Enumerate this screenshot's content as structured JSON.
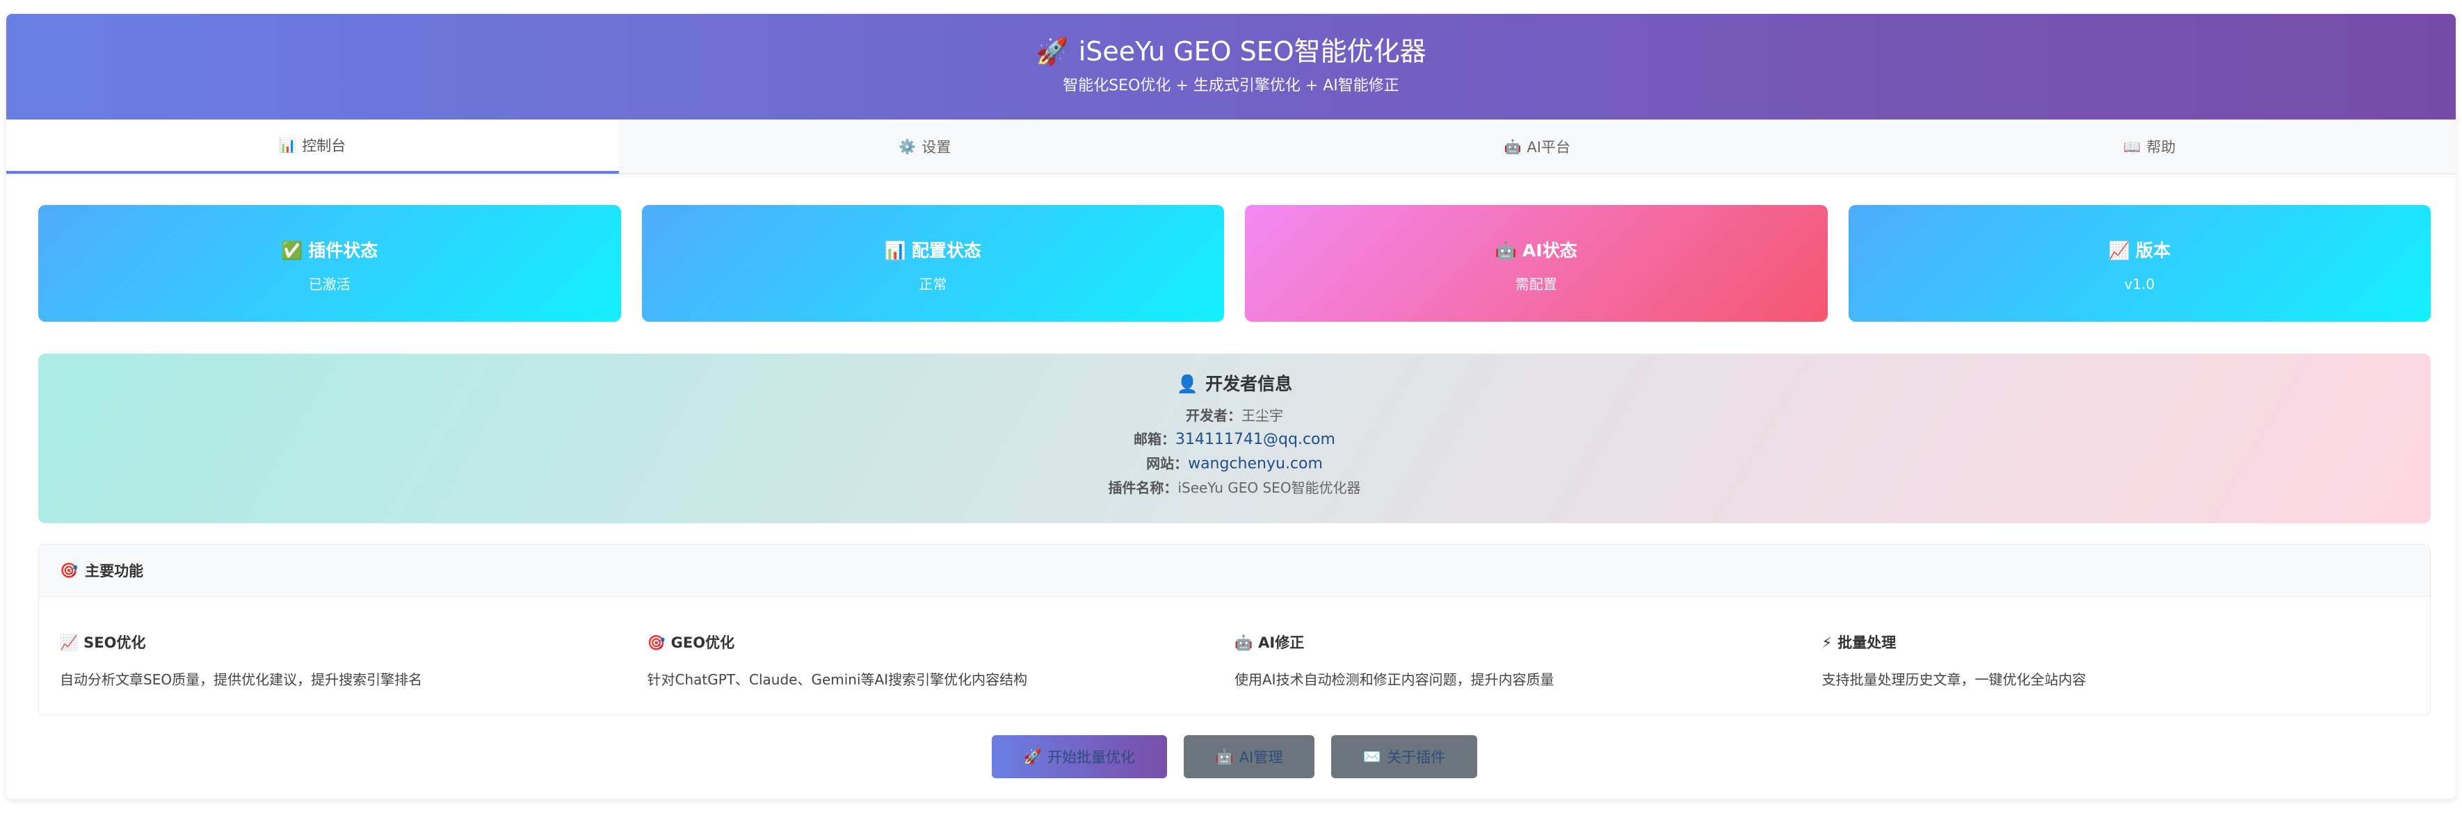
{
  "header": {
    "icon": "rocket-icon",
    "icon_glyph": "🚀",
    "title": "iSeeYu GEO SEO智能优化器",
    "subtitle": "智能化SEO优化 + 生成式引擎优化 + AI智能修正"
  },
  "tabs": [
    {
      "label": "控制台",
      "icon": "bar-chart-icon",
      "icon_glyph": "📊",
      "active": true
    },
    {
      "label": "设置",
      "icon": "gear-icon",
      "icon_glyph": "⚙️",
      "active": false
    },
    {
      "label": "AI平台",
      "icon": "robot-icon",
      "icon_glyph": "🤖",
      "active": false
    },
    {
      "label": "帮助",
      "icon": "book-icon",
      "icon_glyph": "📖",
      "active": false
    }
  ],
  "status_cards": [
    {
      "title": "插件状态",
      "value": "已激活",
      "icon": "check-icon",
      "icon_glyph": "✅",
      "color": "#4facfe"
    },
    {
      "title": "配置状态",
      "value": "正常",
      "icon": "bar-chart-icon",
      "icon_glyph": "📊",
      "color": "#4facfe"
    },
    {
      "title": "AI状态",
      "value": "需配置",
      "icon": "robot-icon",
      "icon_glyph": "🤖",
      "color": "#f5576c"
    },
    {
      "title": "版本",
      "value": "v1.0",
      "icon": "trend-icon",
      "icon_glyph": "📈",
      "color": "#4facfe"
    }
  ],
  "developer": {
    "title": "开发者信息",
    "icon": "person-icon",
    "icon_glyph": "👤",
    "developer_label": "开发者：",
    "developer_value": "王尘宇",
    "email_label": "邮箱：",
    "email_value": "314111741@qq.com",
    "website_label": "网站：",
    "website_value": "wangchenyu.com",
    "plugin_label": "插件名称：",
    "plugin_value": "iSeeYu GEO SEO智能优化器"
  },
  "features": {
    "title": "主要功能",
    "icon": "target-icon",
    "icon_glyph": "🎯",
    "items": [
      {
        "title": "SEO优化",
        "icon": "trend-icon",
        "icon_glyph": "📈",
        "desc": "自动分析文章SEO质量，提供优化建议，提升搜索引擎排名"
      },
      {
        "title": "GEO优化",
        "icon": "target-icon",
        "icon_glyph": "🎯",
        "desc": "针对ChatGPT、Claude、Gemini等AI搜索引擎优化内容结构"
      },
      {
        "title": "AI修正",
        "icon": "robot-icon",
        "icon_glyph": "🤖",
        "desc": "使用AI技术自动检测和修正内容问题，提升内容质量"
      },
      {
        "title": "批量处理",
        "icon": "lightning-icon",
        "icon_glyph": "⚡",
        "desc": "支持批量处理历史文章，一键优化全站内容"
      }
    ]
  },
  "actions": {
    "start_label": "开始批量优化",
    "start_icon_glyph": "🚀",
    "ai_label": "AI管理",
    "ai_icon_glyph": "🤖",
    "about_label": "关于插件",
    "about_icon_glyph": "✉️"
  }
}
